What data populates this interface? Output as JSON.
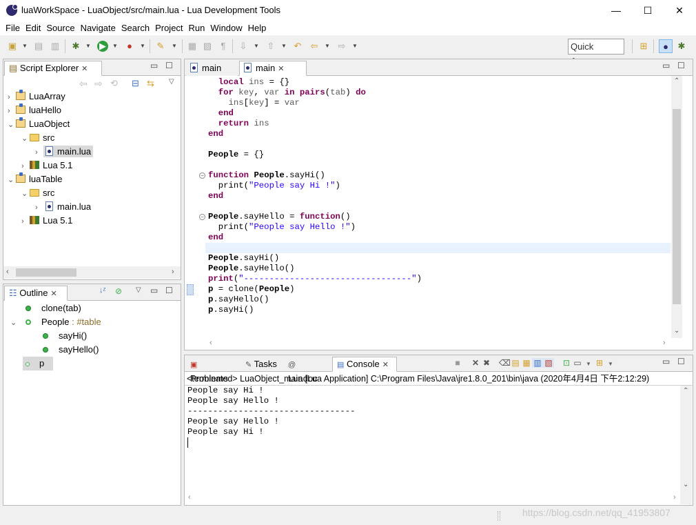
{
  "window": {
    "title": "luaWorkSpace - LuaObject/src/main.lua - Lua Development Tools",
    "minimize": "—",
    "maximize": "☐",
    "close": "✕"
  },
  "menu": [
    "File",
    "Edit",
    "Source",
    "Navigate",
    "Search",
    "Project",
    "Run",
    "Window",
    "Help"
  ],
  "toolbar": {
    "quick_access": "Quick Access"
  },
  "script_explorer": {
    "tab_label": "Script Explorer",
    "tree": [
      {
        "label": "LuaArray",
        "type": "project",
        "expanded": false
      },
      {
        "label": "luaHello",
        "type": "project",
        "expanded": false
      },
      {
        "label": "LuaObject",
        "type": "project",
        "expanded": true
      },
      {
        "label": "src",
        "type": "folder",
        "expanded": true
      },
      {
        "label": "main.lua",
        "type": "file",
        "selected": true
      },
      {
        "label": "Lua 5.1",
        "type": "library",
        "expanded": false
      },
      {
        "label": "luaTable",
        "type": "project",
        "expanded": true
      },
      {
        "label": "src",
        "type": "folder",
        "expanded": true
      },
      {
        "label": "main.lua",
        "type": "file"
      },
      {
        "label": "Lua 5.1",
        "type": "library",
        "expanded": false
      }
    ]
  },
  "outline": {
    "tab_label": "Outline",
    "items": [
      {
        "label": "clone(tab)"
      },
      {
        "label": "People",
        "suffix": " : #table"
      },
      {
        "label": "sayHi()"
      },
      {
        "label": "sayHello()"
      },
      {
        "label": "p"
      }
    ]
  },
  "editor": {
    "tabs": [
      {
        "label": "main"
      },
      {
        "label": "main"
      }
    ],
    "code": [
      "  local ins = {}",
      "  for key, var in pairs(tab) do",
      "    ins[key] = var",
      "  end",
      "  return ins",
      "end",
      "",
      "People = {}",
      "",
      "function People.sayHi()",
      "  print(\"People say Hi !\")",
      "end",
      "",
      "People.sayHello = function()",
      "  print(\"People say Hello !\")",
      "end",
      "",
      "People.sayHi()",
      "People.sayHello()",
      "print(\"---------------------------------\")",
      "p = clone(People)",
      "p.sayHello()",
      "p.sayHi()"
    ]
  },
  "bottom": {
    "tabs": [
      {
        "label": "Problems"
      },
      {
        "label": "Tasks"
      },
      {
        "label": "Luadoc"
      },
      {
        "label": "Console"
      }
    ],
    "status_line": "<terminated> LuaObject_main [Lua Application] C:\\Program Files\\Java\\jre1.8.0_201\\bin\\java (2020年4月4日 下午2:12:29)",
    "output": [
      "People say Hi !",
      "People say Hello !",
      "---------------------------------",
      "People say Hello !",
      "People say Hi !"
    ]
  },
  "watermark": "https://blog.csdn.net/qq_41953807",
  "colors": {
    "keyword": "#7f0055",
    "string": "#2a00ff",
    "accent": "#3399ff"
  }
}
